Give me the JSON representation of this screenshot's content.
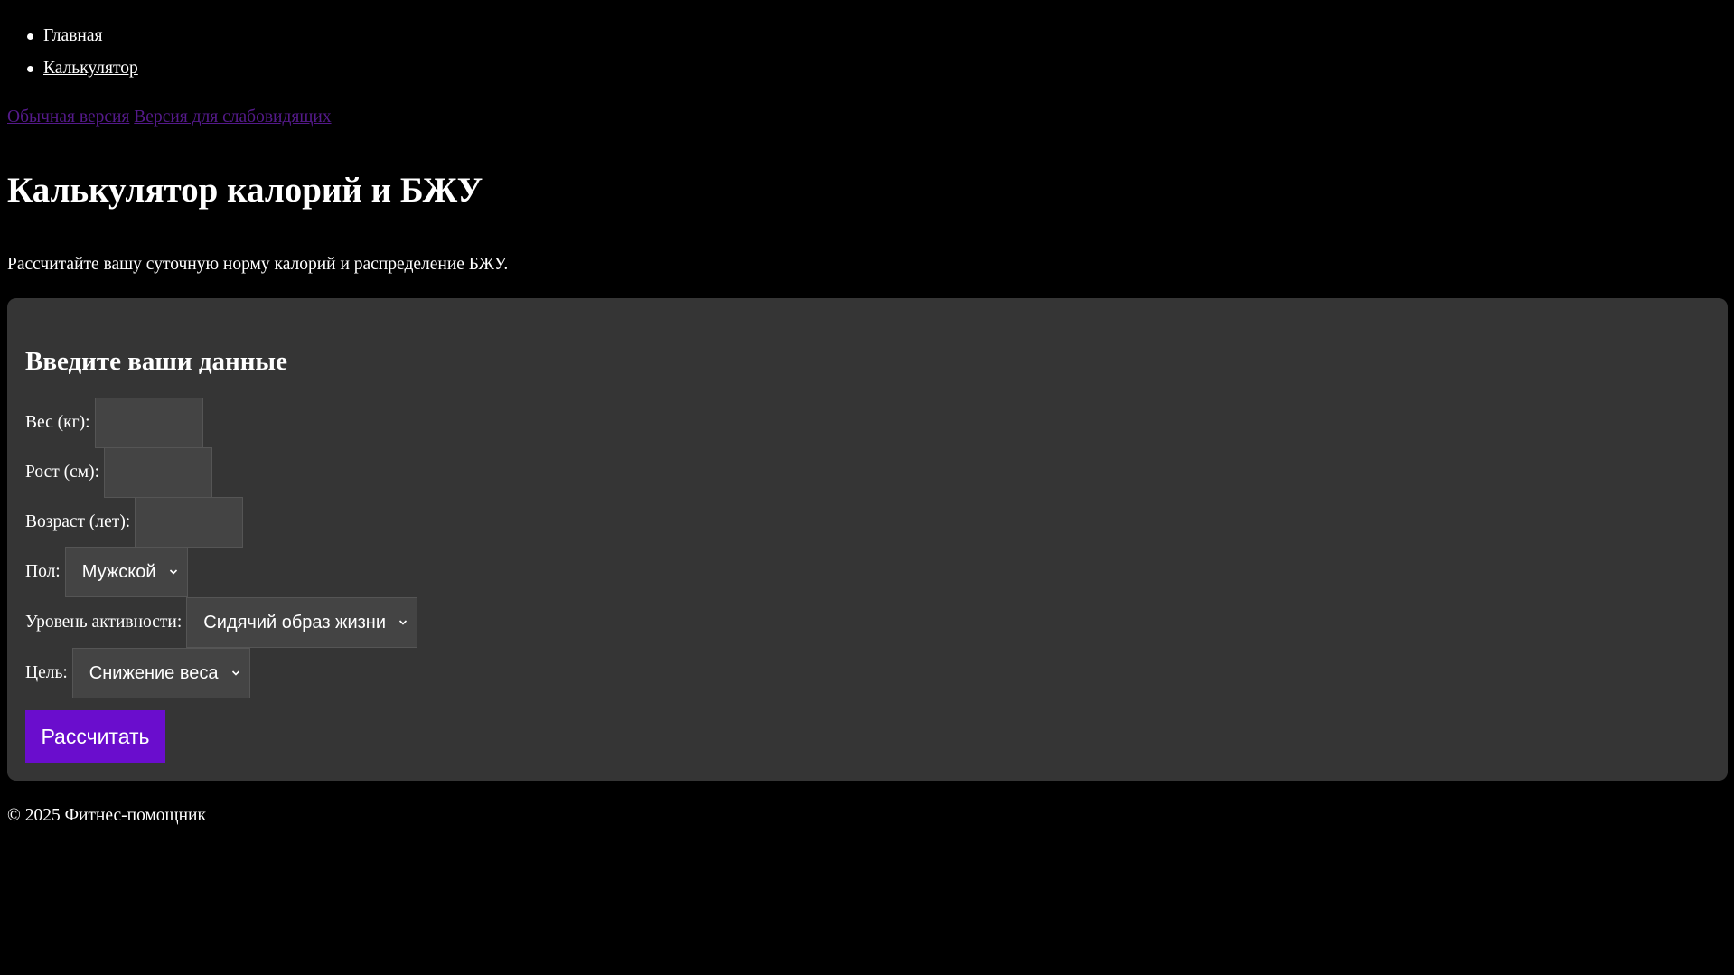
{
  "nav": {
    "items": [
      {
        "label": "Главная"
      },
      {
        "label": "Калькулятор"
      }
    ]
  },
  "versions": {
    "normal": "Обычная версия",
    "low_vision": "Версия для слабовидящих"
  },
  "page": {
    "title": "Калькулятор калорий и БЖУ",
    "intro": "Рассчитайте вашу суточную норму калорий и распределение БЖУ."
  },
  "form": {
    "heading": "Введите ваши данные",
    "weight_label": "Вес (кг):",
    "weight_value": "",
    "height_label": "Рост (см):",
    "height_value": "",
    "age_label": "Возраст (лет):",
    "age_value": "",
    "gender_label": "Пол:",
    "gender_selected": "Мужской",
    "activity_label": "Уровень активности:",
    "activity_selected": "Сидячий образ жизни",
    "goal_label": "Цель:",
    "goal_selected": "Снижение веса",
    "submit_label": "Рассчитать"
  },
  "footer": {
    "text": "© 2025 Фитнес-помощник"
  },
  "colors": {
    "background": "#000000",
    "card": "#353535",
    "field": "#444444",
    "accent": "#6a0dcd",
    "visited_link": "#551a8b"
  },
  "icons": {
    "select_arrow": "chevron-down-icon"
  }
}
